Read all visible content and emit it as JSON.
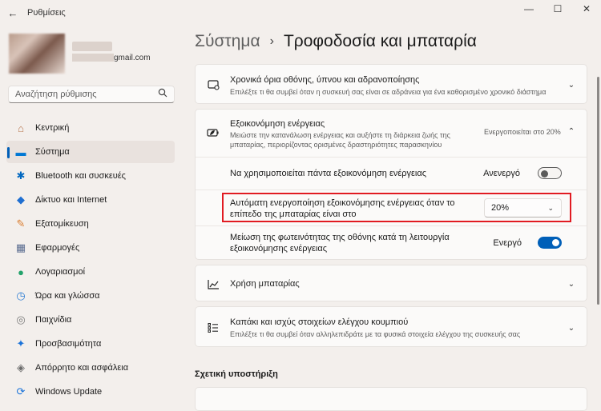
{
  "app": {
    "title": "Ρυθμίσεις"
  },
  "window": {
    "minimize": "—",
    "maximize": "☐",
    "close": "✕"
  },
  "user": {
    "email_suffix": "gmail.com"
  },
  "search": {
    "placeholder": "Αναζήτηση ρύθμισης"
  },
  "nav": {
    "items": [
      {
        "label": "Κεντρική",
        "icon": "home-icon",
        "glyph": "⌂",
        "color": "#b87850"
      },
      {
        "label": "Σύστημα",
        "icon": "system-icon",
        "glyph": "▬",
        "color": "#0078d4",
        "active": true
      },
      {
        "label": "Bluetooth και συσκευές",
        "icon": "bluetooth-icon",
        "glyph": "✱",
        "color": "#0067c0"
      },
      {
        "label": "Δίκτυο και Internet",
        "icon": "network-icon",
        "glyph": "◆",
        "color": "#1f6fd1"
      },
      {
        "label": "Εξατομίκευση",
        "icon": "brush-icon",
        "glyph": "✎",
        "color": "#d97a2b"
      },
      {
        "label": "Εφαρμογές",
        "icon": "apps-icon",
        "glyph": "▦",
        "color": "#5c6e91"
      },
      {
        "label": "Λογαριασμοί",
        "icon": "account-icon",
        "glyph": "●",
        "color": "#23a26b"
      },
      {
        "label": "Ώρα και γλώσσα",
        "icon": "time-language-icon",
        "glyph": "◷",
        "color": "#2b7cd3"
      },
      {
        "label": "Παιχνίδια",
        "icon": "gaming-icon",
        "glyph": "◎",
        "color": "#7a7a7a"
      },
      {
        "label": "Προσβασιμότητα",
        "icon": "accessibility-icon",
        "glyph": "✦",
        "color": "#1a73d9"
      },
      {
        "label": "Απόρρητο και ασφάλεια",
        "icon": "shield-icon",
        "glyph": "◈",
        "color": "#6b6b6b"
      },
      {
        "label": "Windows Update",
        "icon": "update-icon",
        "glyph": "⟳",
        "color": "#1a73d9"
      }
    ]
  },
  "breadcrumb": {
    "parent": "Σύστημα",
    "separator": "›",
    "current": "Τροφοδοσία και μπαταρία"
  },
  "screen_sleep": {
    "title": "Χρονικά όρια οθόνης, ύπνου και αδρανοποίησης",
    "desc": "Επιλέξτε τι θα συμβεί όταν η συσκευή σας είναι σε αδράνεια για ένα καθορισμένο χρονικό διάστημα"
  },
  "energy_saver": {
    "title": "Εξοικονόμηση ενέργειας",
    "desc_line1": "Μειώστε την κατανάλωση ενέργειας και αυξήστε τη διάρκεια ζωής της",
    "desc_line2": "μπαταρίας, περιορίζοντας ορισμένες δραστηριότητες παρασκηνίου",
    "status": "Ενεργοποιείται στο 20%",
    "always_use": {
      "label": "Να χρησιμοποιείται πάντα εξοικονόμηση ενέργειας",
      "state": "Ανενεργό",
      "on": false
    },
    "auto_on": {
      "label_line1": "Αυτόματη ενεργοποίηση εξοικονόμησης ενέργειας όταν το",
      "label_line2": "επίπεδο της μπαταρίας είναι στο",
      "value": "20%"
    },
    "lower_brightness": {
      "label_line1": "Μείωση της φωτεινότητας της οθόνης κατά τη λειτουργία",
      "label_line2": "εξοικονόμησης ενέργειας",
      "state": "Ενεργό",
      "on": true
    }
  },
  "battery_usage": {
    "title": "Χρήση μπαταρίας"
  },
  "lid_power": {
    "title": "Καπάκι και ισχύς στοιχείων ελέγχου κουμπιού",
    "desc": "Επιλέξτε τι θα συμβεί όταν αλληλεπιδράτε με τα φυσικά στοιχεία ελέγχου της συσκευής σας"
  },
  "related": {
    "title": "Σχετική υποστήριξη"
  }
}
